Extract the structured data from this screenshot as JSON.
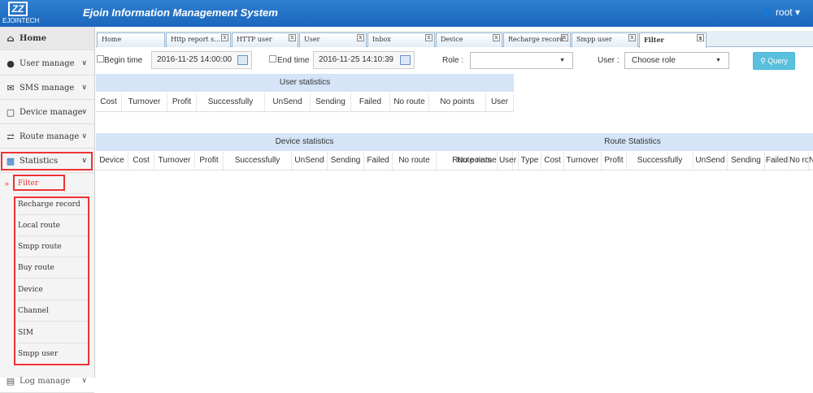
{
  "app": {
    "logo_mark": "ZZ",
    "logo_text": "EJOINTECH",
    "title": "Ejoin Information Management System",
    "user": "root"
  },
  "sidebar": {
    "home": "Home",
    "items": [
      "User manage",
      "SMS manage",
      "Device manage",
      "Route manage",
      "Statistics"
    ],
    "sub_items": [
      "Filter",
      "Recharge record",
      "Local route",
      "Smpp route",
      "Buy route",
      "Device",
      "Channel",
      "SIM",
      "Smpp user"
    ],
    "next_item": "Log manage"
  },
  "tabs": [
    "Home",
    "Http report s…",
    "HTTP user",
    "User",
    "Inbox",
    "Device",
    "Recharge record",
    "Smpp user",
    "Filter"
  ],
  "filter": {
    "begin_label": "Begin time",
    "begin_value": "2016-11-25 14:00:00",
    "end_label": "End time",
    "end_value": "2016-11-25 14:10:39",
    "role_label": "Role :",
    "role_value": "",
    "user_label": "User :",
    "user_value": "Choose role",
    "query_label": "Query"
  },
  "user_stats": {
    "title": "User statistics",
    "columns": [
      "Cost",
      "Turnover",
      "Profit",
      "Successfully",
      "UnSend",
      "Sending",
      "Failed",
      "No route",
      "No points",
      "User"
    ]
  },
  "device_stats": {
    "title": "Device statistics",
    "columns": [
      "Device",
      "Cost",
      "Turnover",
      "Profit",
      "Successfully",
      "UnSend",
      "Sending",
      "Failed",
      "No route",
      "No points"
    ]
  },
  "route_stats": {
    "title": "Route Statistics",
    "columns": [
      "Route name",
      "User",
      "Type",
      "Cost",
      "Turnover",
      "Profit",
      "Successfully",
      "UnSend",
      "Sending",
      "Failed",
      "No route",
      "No"
    ]
  },
  "colors": {
    "topbar": "#1f6fc4",
    "section_header": "#d5e5f7",
    "query": "#5bc0de",
    "highlight": "#e33333"
  }
}
